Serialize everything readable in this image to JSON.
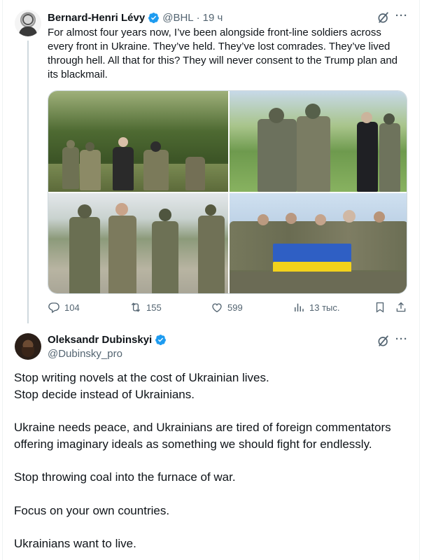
{
  "parent_tweet": {
    "author_name": "Bernard-Henri Lévy",
    "author_handle": "@BHL",
    "separator": "·",
    "time": "19 ч",
    "text": "For almost four years now, I’ve been alongside front-line soldiers across every front in Ukraine. They’ve held. They’ve lost comrades. They’ve lived through hell. All that for this? They will never consent to the Trump plan and its blackmail.",
    "actions": {
      "replies": "104",
      "reposts": "155",
      "likes": "599",
      "views": "13 тыс."
    },
    "icons": [
      "verified-badge-icon",
      "grok-icon",
      "more-icon",
      "reply-icon",
      "repost-icon",
      "like-icon",
      "views-icon",
      "bookmark-icon",
      "share-icon"
    ]
  },
  "reply_tweet": {
    "author_name": "Oleksandr Dubinskyi",
    "author_handle": "@Dubinsky_pro",
    "paragraphs": [
      [
        "Stop writing novels at the cost of Ukrainian lives.",
        "Stop decide instead of Ukrainians."
      ],
      [
        "Ukraine needs peace, and Ukrainians are tired of foreign commentators offering imaginary ideals as something we should fight for endlessly."
      ],
      [
        "Stop throwing coal into the furnace of war."
      ],
      [
        "Focus on your own countries."
      ],
      [
        "Ukrainians want to live."
      ]
    ]
  },
  "colors": {
    "text": "#0f1419",
    "muted": "#536471",
    "verified": "#1d9bf0",
    "border": "#cfd9de",
    "flag_blue": "#2f5fc4",
    "flag_yellow": "#f3d21c"
  }
}
